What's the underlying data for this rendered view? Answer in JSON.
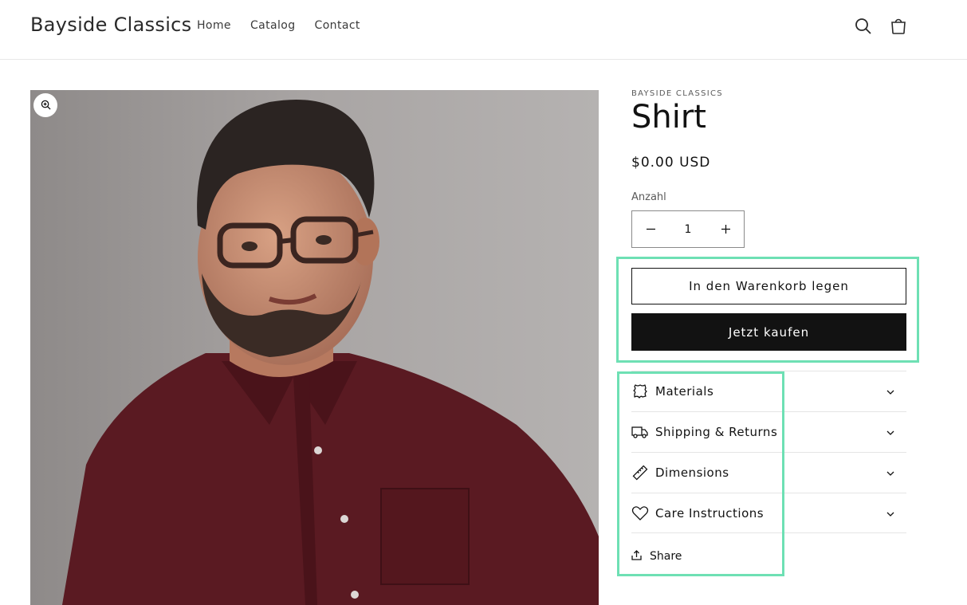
{
  "header": {
    "logo": "Bayside Classics",
    "nav": [
      "Home",
      "Catalog",
      "Contact"
    ],
    "icons": {
      "search": "search-icon",
      "cart": "cart-icon"
    }
  },
  "media": {
    "zoom_icon": "zoom-icon",
    "colors": {
      "background": "#a7a3a2",
      "shirt": "#5a1a22"
    }
  },
  "product": {
    "vendor": "BAYSIDE CLASSICS",
    "title": "Shirt",
    "price": "$0.00 USD",
    "quantity_label": "Anzahl",
    "quantity": "1",
    "add_to_cart": "In den Warenkorb legen",
    "buy_now": "Jetzt kaufen"
  },
  "accordion": [
    {
      "label": "Materials",
      "icon": "materials-icon"
    },
    {
      "label": "Shipping & Returns",
      "icon": "truck-icon"
    },
    {
      "label": "Dimensions",
      "icon": "ruler-icon"
    },
    {
      "label": "Care Instructions",
      "icon": "heart-icon"
    }
  ],
  "share": {
    "label": "Share",
    "icon": "share-icon"
  },
  "colors": {
    "accent_highlight": "#6ee0b4",
    "primary_button": "#121212"
  }
}
